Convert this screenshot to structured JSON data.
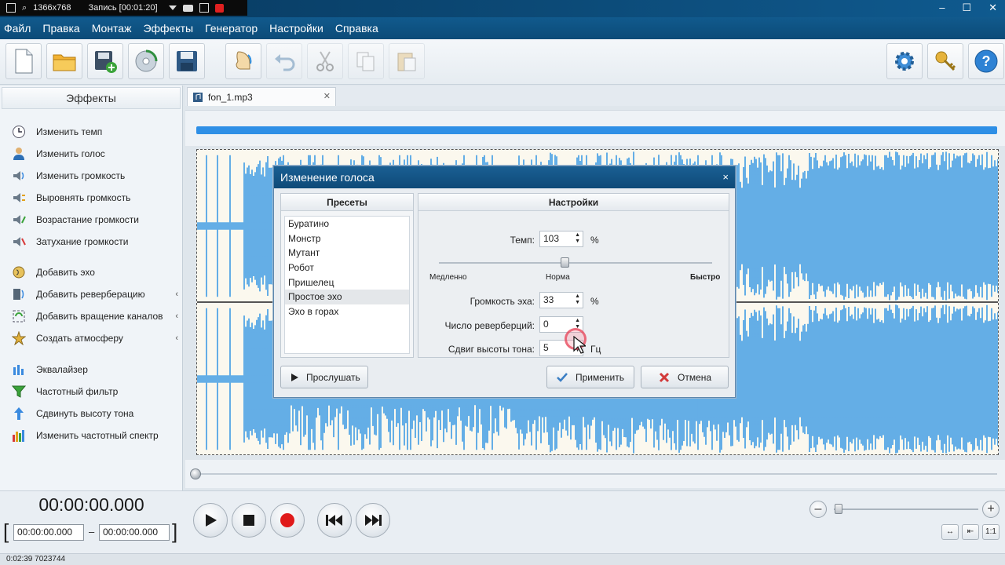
{
  "recorder": {
    "resolution": "1366x768",
    "status": "Запись [00:01:20]"
  },
  "menu": [
    "Файл",
    "Правка",
    "Монтаж",
    "Эффекты",
    "Генератор",
    "Настройки",
    "Справка"
  ],
  "toolbar": {
    "buttons": [
      "new-file-icon",
      "open-folder-icon",
      "add-file-icon",
      "cd-icon",
      "save-icon",
      "voice-icon",
      "undo-icon",
      "cut-icon",
      "copy-icon",
      "paste-icon"
    ],
    "right_buttons": [
      "settings-gear-icon",
      "key-icon",
      "help-icon"
    ]
  },
  "sidebar": {
    "title": "Эффекты",
    "items": [
      {
        "label": "Изменить темп",
        "icon": "clock-icon"
      },
      {
        "label": "Изменить голос",
        "icon": "person-icon"
      },
      {
        "label": "Изменить громкость",
        "icon": "volume-icon"
      },
      {
        "label": "Выровнять громкость",
        "icon": "normalize-icon"
      },
      {
        "label": "Возрастание громкости",
        "icon": "fade-in-icon"
      },
      {
        "label": "Затухание громкости",
        "icon": "fade-out-icon"
      },
      {
        "label": "Добавить эхо",
        "icon": "echo-icon"
      },
      {
        "label": "Добавить реверберацию",
        "icon": "reverb-icon"
      },
      {
        "label": "Добавить вращение каналов",
        "icon": "rotate-icon"
      },
      {
        "label": "Создать атмосферу",
        "icon": "atmosphere-icon"
      },
      {
        "label": "Эквалайзер",
        "icon": "equalizer-icon"
      },
      {
        "label": "Частотный фильтр",
        "icon": "filter-icon"
      },
      {
        "label": "Сдвинуть высоту тона",
        "icon": "pitch-icon"
      },
      {
        "label": "Изменить частотный спектр",
        "icon": "spectrum-icon"
      }
    ]
  },
  "tab": {
    "label": "fon_1.mp3",
    "close": "✕"
  },
  "transport": {
    "time": "00:00:00.000",
    "start": "00:00:00.000",
    "end": "00:00:00.000",
    "dash": "–",
    "bracket_left": "[",
    "bracket_right": "]"
  },
  "zoom": {
    "minus": "–",
    "plus": "+",
    "fit": "↔",
    "sel": "⇤",
    "one": "1:1"
  },
  "status": {
    "text": "0:02:39 7023744"
  },
  "dialog": {
    "title": "Изменение голоса",
    "close": "×",
    "presets_title": "Пресеты",
    "presets": [
      "Буратино",
      "Монстр",
      "Мутант",
      "Робот",
      "Пришелец",
      "Простое эхо",
      "Эхо в горах"
    ],
    "selected_preset": "Простое эхо",
    "settings_title": "Настройки",
    "tempo_label": "Темп:",
    "tempo_value": "103",
    "tempo_unit": "%",
    "slow": "Медленно",
    "normal": "Норма",
    "fast": "Быстро",
    "echo_label": "Громкость эха:",
    "echo_value": "33",
    "echo_unit": "%",
    "reverb_label": "Число реверберций:",
    "reverb_value": "0",
    "pitch_label": "Сдвиг высоты тона:",
    "pitch_value": "5",
    "pitch_unit": "Гц",
    "listen": "Прослушать",
    "apply": "Применить",
    "cancel": "Отмена"
  },
  "colors": {
    "wave": "#3f9be4",
    "accent": "#0c4b78",
    "progress": "#2e8fe6"
  }
}
